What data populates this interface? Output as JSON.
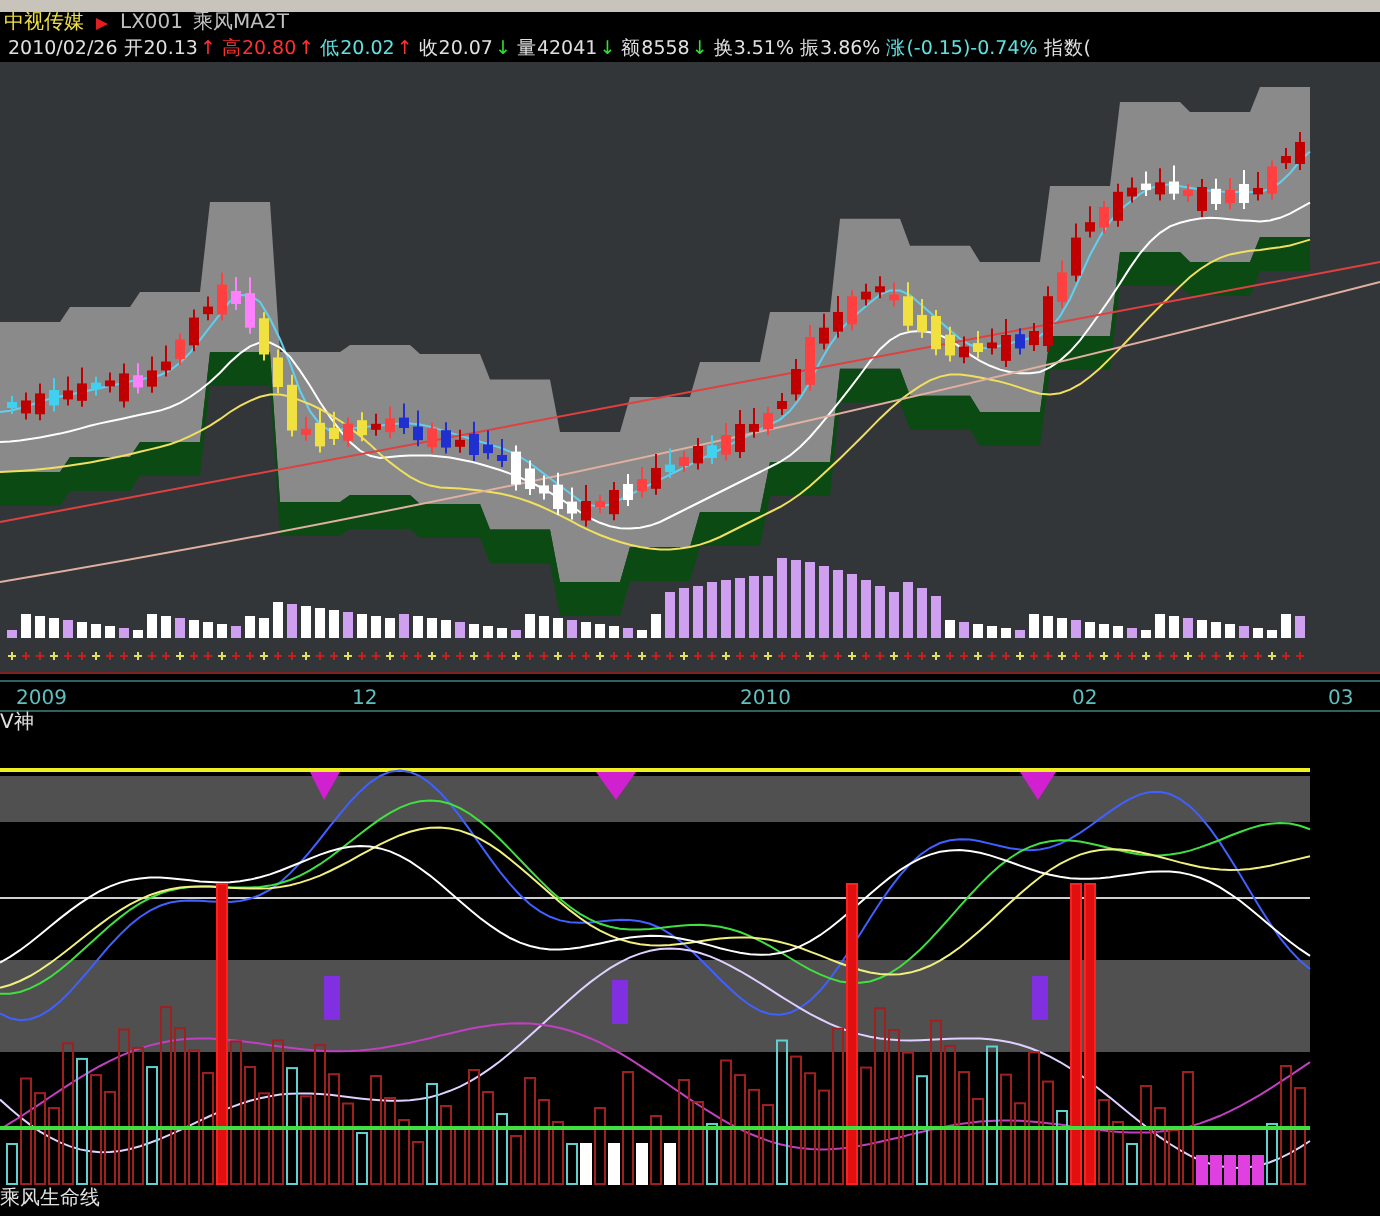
{
  "stock": {
    "name": "中视传媒",
    "formula_code": "LX001",
    "formula_name": "乘风MA2T"
  },
  "quote": [
    {
      "text": "2010/02/26",
      "color": "#e0e0e0"
    },
    {
      "text": "开20.13",
      "arrow": "↑",
      "color": "#e0e0e0"
    },
    {
      "text": "高20.80",
      "arrow": "↑",
      "color": "#ff3030"
    },
    {
      "text": "低20.02",
      "arrow": "↑",
      "color": "#60e0e0"
    },
    {
      "text": "收20.07",
      "arrow": "↓",
      "color": "#e0e0e0"
    },
    {
      "text": "量42041",
      "arrow": "↓",
      "color": "#e0e0e0"
    },
    {
      "text": "额8558",
      "arrow": "↓",
      "color": "#e0e0e0"
    },
    {
      "text": "换3.51%",
      "color": "#e0e0e0"
    },
    {
      "text": "振3.86%",
      "color": "#e0e0e0"
    },
    {
      "text": "涨(-0.15)-0.74%",
      "color": "#60e0e0"
    },
    {
      "text": "指数(",
      "color": "#e0e0e0"
    }
  ],
  "time_axis": {
    "labels": [
      "2009",
      "12",
      "2010",
      "02",
      "03"
    ]
  },
  "indicator": {
    "title": "V神"
  },
  "footer": {
    "title": "乘风生命线"
  }
}
